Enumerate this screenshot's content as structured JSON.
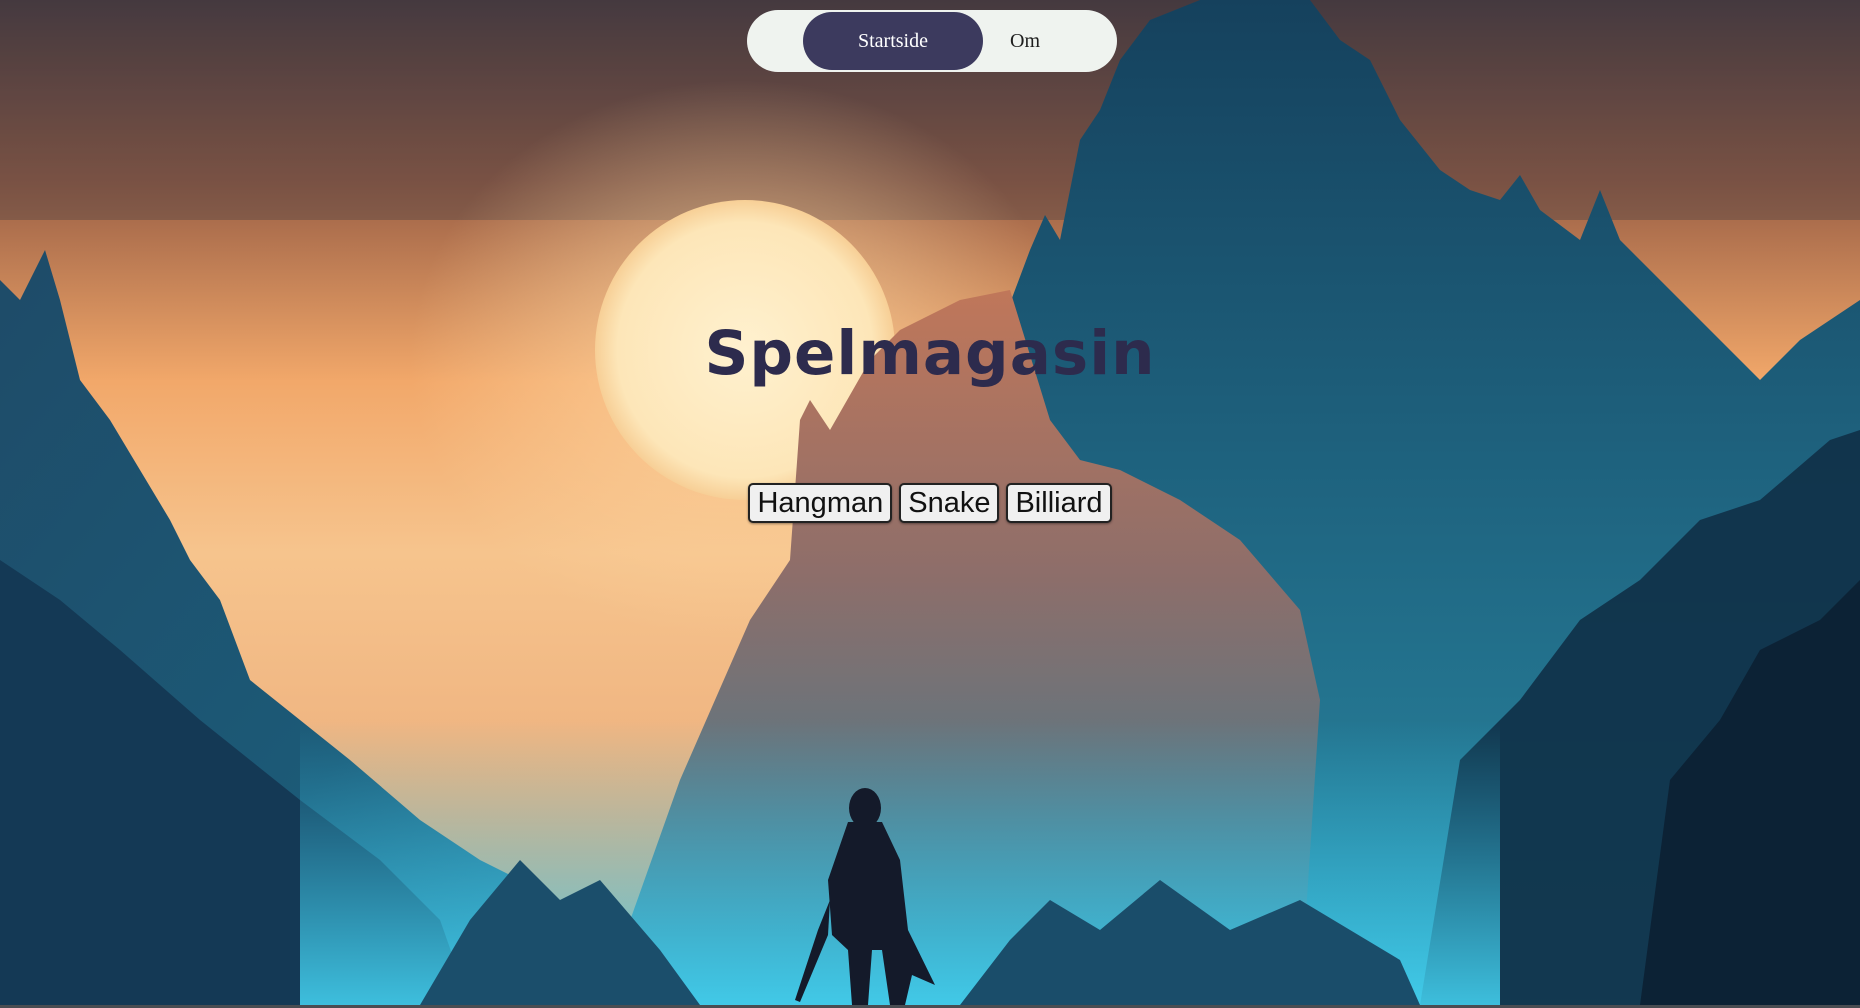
{
  "nav": {
    "items": [
      {
        "label": "Startside",
        "active": true
      },
      {
        "label": "Om",
        "active": false
      }
    ],
    "active_color": "#3c3a5e",
    "background_color": "#eff3ef"
  },
  "page": {
    "title": "Spelmagasin",
    "title_color": "#2d2b4d"
  },
  "games": [
    {
      "label": "Hangman"
    },
    {
      "label": "Snake"
    },
    {
      "label": "Billiard"
    }
  ]
}
